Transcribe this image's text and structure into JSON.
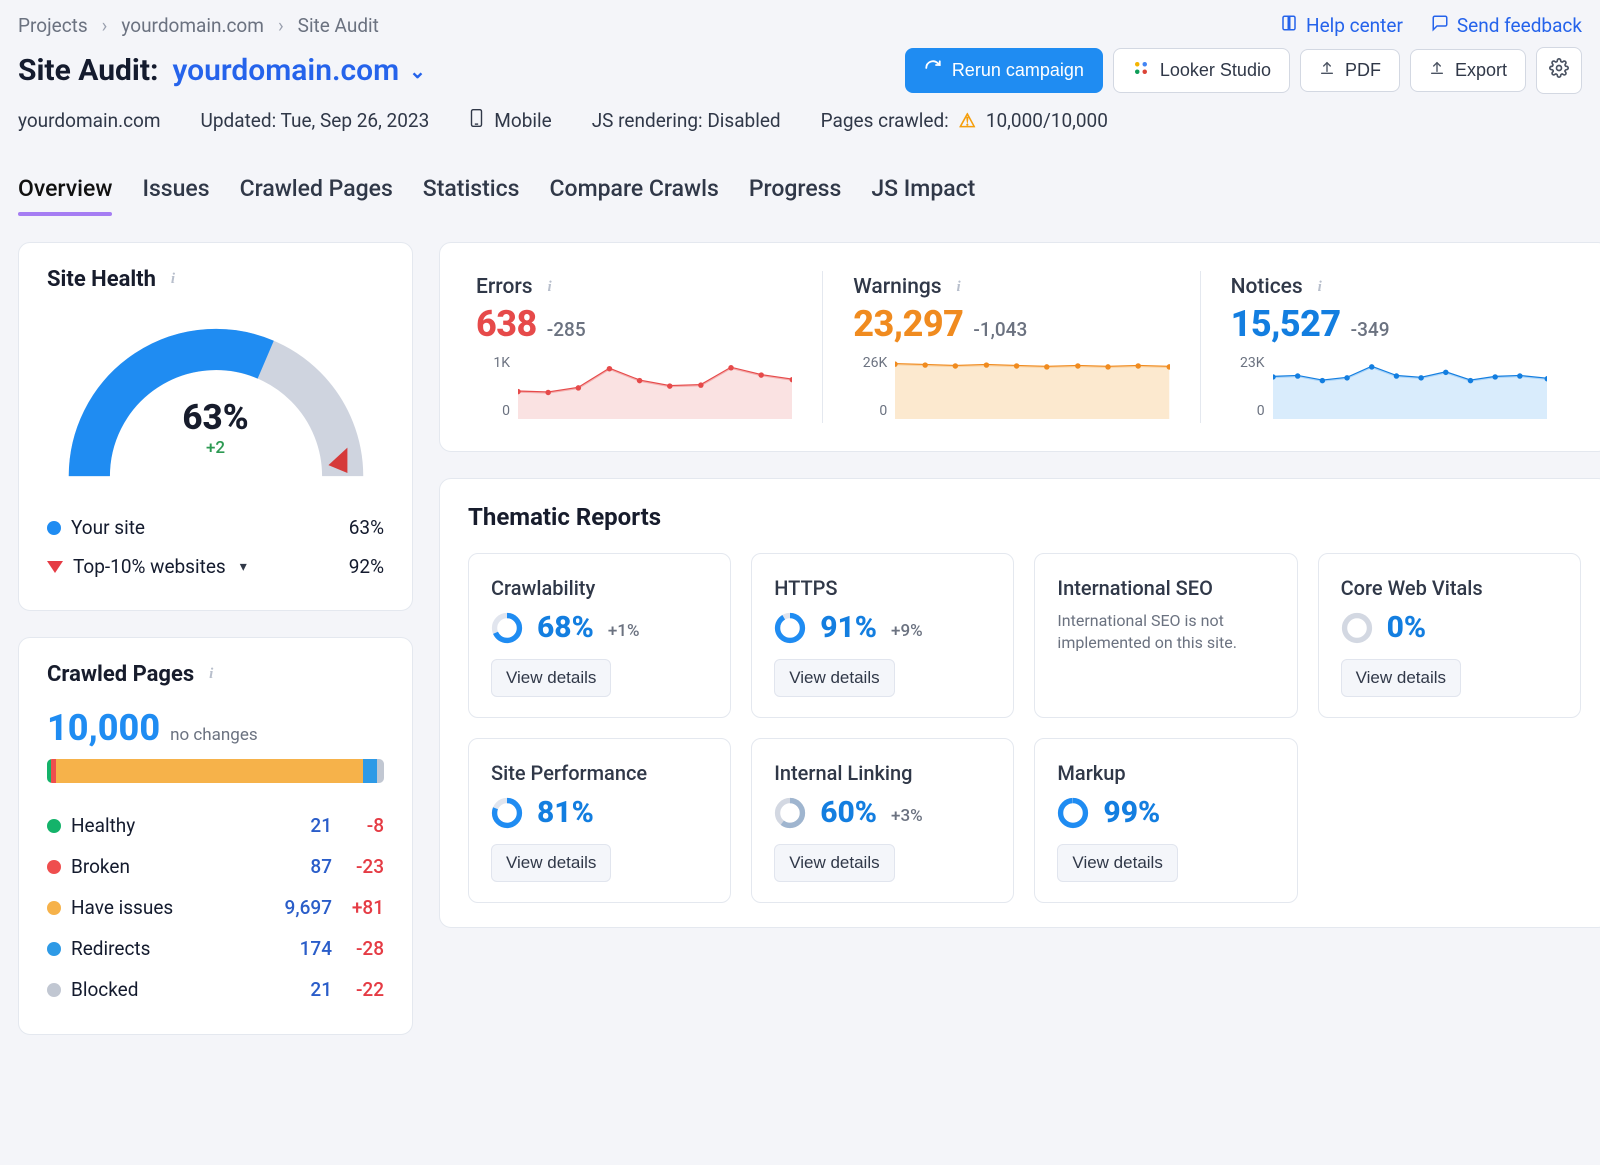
{
  "breadcrumbs": [
    "Projects",
    "yourdomain.com",
    "Site Audit"
  ],
  "top_links": {
    "help": "Help center",
    "feedback": "Send feedback"
  },
  "title": {
    "prefix": "Site Audit:",
    "domain": "yourdomain.com"
  },
  "actions": {
    "rerun": "Rerun campaign",
    "looker": "Looker Studio",
    "pdf": "PDF",
    "export": "Export"
  },
  "meta": {
    "domain_plain": "yourdomain.com",
    "updated": "Updated: Tue, Sep 26, 2023",
    "device": "Mobile",
    "js_rendering": "JS rendering: Disabled",
    "pages_crawled_label": "Pages crawled:",
    "pages_crawled_value": "10,000/10,000"
  },
  "tabs": [
    "Overview",
    "Issues",
    "Crawled Pages",
    "Statistics",
    "Compare Crawls",
    "Progress",
    "JS Impact"
  ],
  "site_health": {
    "card_title": "Site Health",
    "value_pct": "63%",
    "delta": "+2",
    "legend": [
      {
        "label": "Your site",
        "value": "63%",
        "marker": "blue-dot"
      },
      {
        "label": "Top-10% websites",
        "value": "92%",
        "marker": "red-tri",
        "expandable": true
      }
    ]
  },
  "kpis": {
    "errors": {
      "title": "Errors",
      "value": "638",
      "delta": "-285",
      "color": "#e64a4a",
      "y_top": "1K",
      "y_bot": "0"
    },
    "warnings": {
      "title": "Warnings",
      "value": "23,297",
      "delta": "-1,043",
      "color": "#f08b1f",
      "y_top": "26K",
      "y_bot": "0"
    },
    "notices": {
      "title": "Notices",
      "value": "15,527",
      "delta": "-349",
      "color": "#137ee0",
      "y_top": "23K",
      "y_bot": "0"
    }
  },
  "crawled_pages": {
    "card_title": "Crawled Pages",
    "total": "10,000",
    "sub": "no changes",
    "breakdown": [
      {
        "label": "Healthy",
        "count": "21",
        "delta": "-8",
        "color": "#14b36a"
      },
      {
        "label": "Broken",
        "count": "87",
        "delta": "-23",
        "color": "#ef4e4e"
      },
      {
        "label": "Have issues",
        "count": "9,697",
        "delta": "+81",
        "color": "#f6b24a"
      },
      {
        "label": "Redirects",
        "count": "174",
        "delta": "-28",
        "color": "#2e9ae6"
      },
      {
        "label": "Blocked",
        "count": "21",
        "delta": "-22",
        "color": "#c1c7d2"
      }
    ]
  },
  "thematic": {
    "card_title": "Thematic Reports",
    "view_details": "View details",
    "reports": [
      {
        "title": "Crawlability",
        "percent": 68,
        "delta": "+1%",
        "has_details": true
      },
      {
        "title": "HTTPS",
        "percent": 91,
        "delta": "+9%",
        "has_details": true
      },
      {
        "title": "International SEO",
        "note": "International SEO is not implemented on this site.",
        "has_details": false
      },
      {
        "title": "Core Web Vitals",
        "percent": 0,
        "delta": "",
        "has_details": true,
        "grey": true
      },
      {
        "title": "Site Performance",
        "percent": 81,
        "delta": "",
        "has_details": true
      },
      {
        "title": "Internal Linking",
        "percent": 60,
        "delta": "+3%",
        "has_details": true,
        "grey_ring": true
      },
      {
        "title": "Markup",
        "percent": 99,
        "delta": "",
        "has_details": true
      }
    ]
  },
  "chart_data": {
    "site_health_gauge": {
      "type": "gauge",
      "value": 63,
      "benchmark": 92,
      "range": [
        0,
        100
      ]
    },
    "sparklines": [
      {
        "name": "Errors",
        "type": "area",
        "ylim": [
          0,
          1000
        ],
        "values": [
          480,
          470,
          520,
          760,
          620,
          560,
          580,
          780,
          700,
          660
        ]
      },
      {
        "name": "Warnings",
        "type": "area",
        "ylim": [
          0,
          26000
        ],
        "values": [
          23800,
          23700,
          23500,
          23700,
          23600,
          23300,
          23500,
          23400,
          23500,
          23300
        ]
      },
      {
        "name": "Notices",
        "type": "area",
        "ylim": [
          0,
          23000
        ],
        "values": [
          15800,
          15900,
          15400,
          15700,
          16800,
          15900,
          15700,
          16200,
          15500,
          15800,
          15900,
          15600
        ]
      }
    ],
    "crawled_bar": {
      "type": "stacked-bar",
      "total": 10000,
      "segments": [
        {
          "name": "Healthy",
          "value": 21
        },
        {
          "name": "Broken",
          "value": 87
        },
        {
          "name": "Have issues",
          "value": 9697
        },
        {
          "name": "Redirects",
          "value": 174
        },
        {
          "name": "Blocked",
          "value": 21
        }
      ]
    }
  }
}
